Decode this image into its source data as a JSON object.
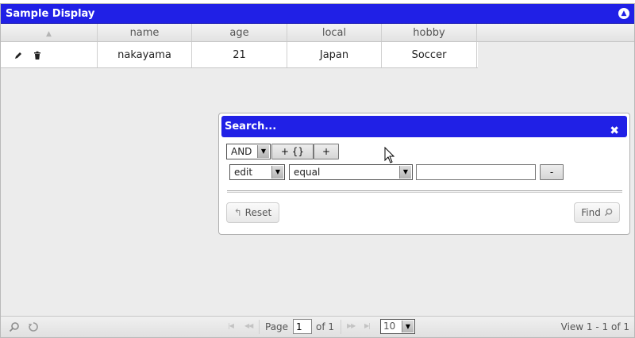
{
  "grid": {
    "caption": "Sample Display",
    "columns": [
      "",
      "name",
      "age",
      "local",
      "hobby"
    ],
    "rows": [
      {
        "name": "nakayama",
        "age": "21",
        "local": "Japan",
        "hobby": "Soccer"
      }
    ]
  },
  "pager": {
    "page_label": "Page",
    "page_value": "1",
    "of_label": "of 1",
    "rows_per_page": "10",
    "view_text": "View 1 - 1 of 1"
  },
  "search_dialog": {
    "title": "Search...",
    "group_op": "AND",
    "add_group_label": "+ {}",
    "add_rule_label": "+",
    "rule": {
      "field": "edit",
      "operator": "equal",
      "value": "",
      "remove_label": "-"
    },
    "reset_label": "Reset",
    "find_label": "Find"
  },
  "colors": {
    "header_blue": "#2020e6",
    "grid_bg": "#ececec"
  }
}
